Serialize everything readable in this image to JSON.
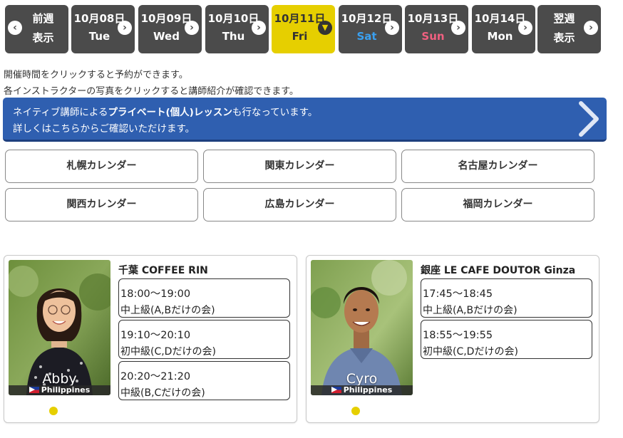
{
  "daynav": {
    "prev": {
      "line1": "前週",
      "line2": "表示"
    },
    "days": [
      {
        "date": "10月08日",
        "dow": "Tue"
      },
      {
        "date": "10月09日",
        "dow": "Wed"
      },
      {
        "date": "10月10日",
        "dow": "Thu"
      },
      {
        "date": "10月11日",
        "dow": "Fri",
        "active": true
      },
      {
        "date": "10月12日",
        "dow": "Sat"
      },
      {
        "date": "10月13日",
        "dow": "Sun"
      },
      {
        "date": "10月14日",
        "dow": "Mon"
      }
    ],
    "next": {
      "line1": "翌週",
      "line2": "表示"
    }
  },
  "notes": {
    "line1": "開催時間をクリックすると予約ができます。",
    "line2": "各インストラクターの写真をクリックすると講師紹介が確認できます。"
  },
  "banner": {
    "l1_a": "ネイティブ講師による",
    "l1_b": "プライベート(個人)レッスン",
    "l1_c": "も行なっています。",
    "l2": "詳しくはこちらからご確認いただけます。"
  },
  "calendars": [
    "札幌カレンダー",
    "関東カレンダー",
    "名古屋カレンダー",
    "関西カレンダー",
    "広島カレンダー",
    "福岡カレンダー"
  ],
  "instructors": [
    {
      "name": "Abby",
      "country": "Philippines",
      "venue": "千葉 COFFEE RIN",
      "slots": [
        {
          "time": "18:00〜19:00",
          "level": "中上級(A,Bだけの会)"
        },
        {
          "time": "19:10〜20:10",
          "level": "初中級(C,Dだけの会)"
        },
        {
          "time": "20:20〜21:20",
          "level": "中級(B,Cだけの会)"
        }
      ]
    },
    {
      "name": "Cyro",
      "country": "Philippines",
      "venue": "銀座 LE CAFE DOUTOR Ginza",
      "slots": [
        {
          "time": "17:45〜18:45",
          "level": "中上級(A,Bだけの会)"
        },
        {
          "time": "18:55〜19:55",
          "level": "初中級(C,Dだけの会)"
        }
      ]
    }
  ],
  "colors": {
    "nav_bg": "#4b4b4b",
    "active": "#e6cf00",
    "banner": "#2f5fb0",
    "sat": "#3aa0f0",
    "sun": "#f06080"
  }
}
